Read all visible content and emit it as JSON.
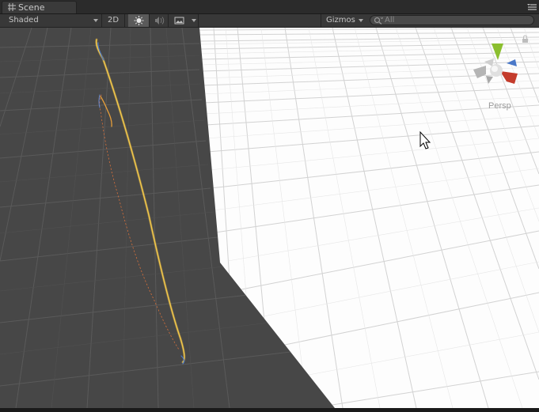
{
  "window": {
    "tab_label": "Scene",
    "tab_icon": "grid-icon",
    "menu_icon": "menu-icon"
  },
  "toolbar": {
    "render_mode": "Shaded",
    "mode_2d": "2D",
    "lighting_icon": "sun-icon",
    "audio_icon": "speaker-icon",
    "effects_icon": "image-icon",
    "gizmos_label": "Gizmos",
    "search_placeholder": "All",
    "search_icon": "search-icon"
  },
  "viewport": {
    "projection_label": "Persp",
    "orientation_gizmo": "scene-gizmo",
    "lock_icon": "lock-icon"
  },
  "colors": {
    "plane_dark": "#474747",
    "background": "#fdfdfd",
    "trail": "#f2b42f",
    "gizmo_y": "#8bbf2f",
    "gizmo_x": "#c43c2c",
    "gizmo_z": "#4a78c8"
  }
}
